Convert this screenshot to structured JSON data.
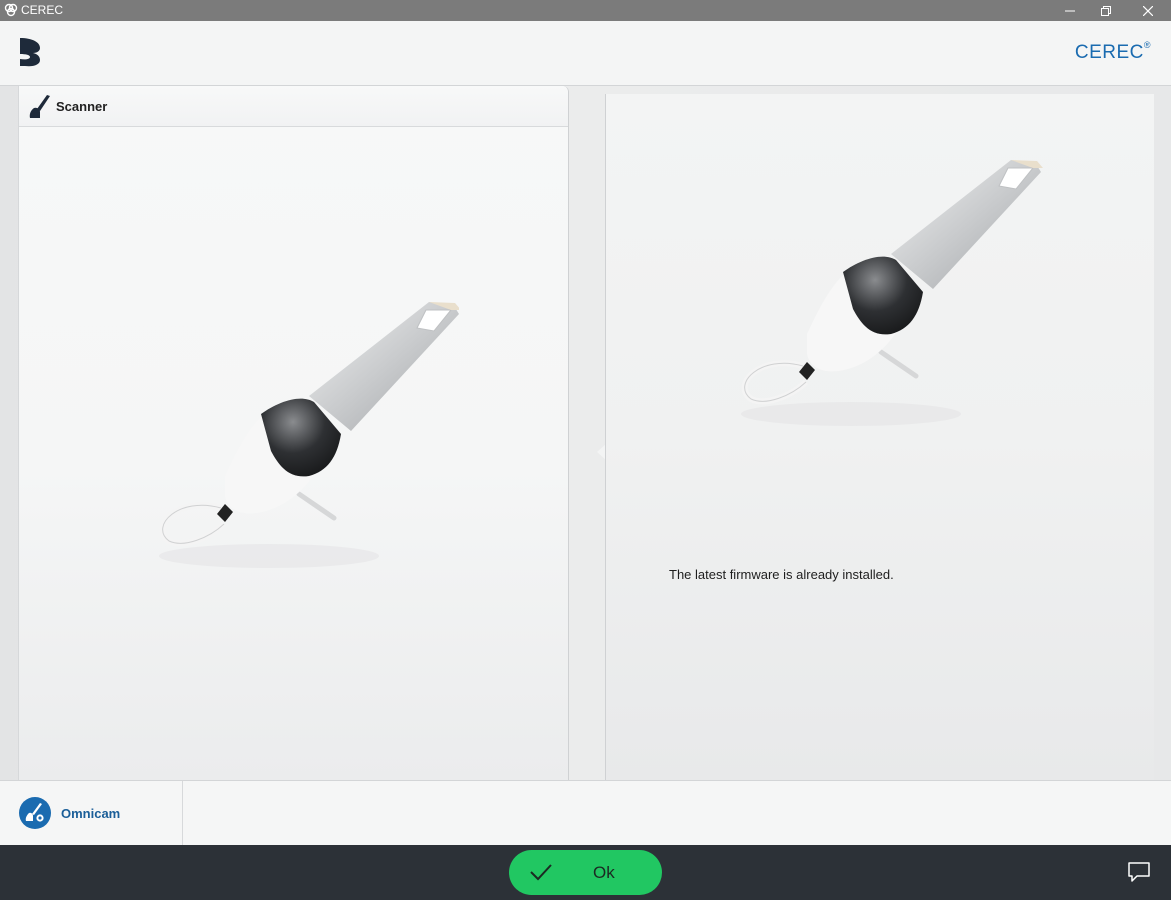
{
  "window": {
    "title": "CEREC"
  },
  "header": {
    "brand": "CEREC",
    "brand_mark": "®"
  },
  "scanner_panel": {
    "title": "Scanner"
  },
  "firmware": {
    "message": "The latest firmware is already installed."
  },
  "device": {
    "name": "Omnicam"
  },
  "actions": {
    "ok_label": "Ok"
  },
  "icons": {
    "app": "cerec-app-icon",
    "logo": "dentsply-logo-icon",
    "scanner": "scanner-icon",
    "device": "omnicam-settings-icon",
    "ok": "checkmark-icon",
    "chat": "chat-icon"
  },
  "colors": {
    "brand_blue": "#1a6bb0",
    "ok_green": "#21c762",
    "bottom_bar": "#2c3137"
  }
}
